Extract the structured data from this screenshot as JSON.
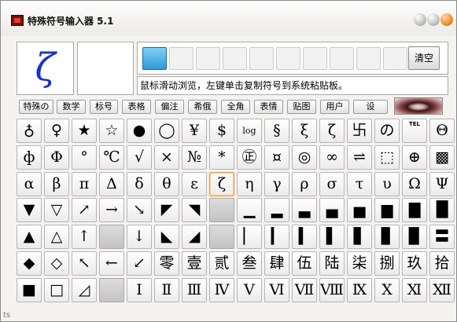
{
  "window": {
    "title": "特殊符号输入器 5.1"
  },
  "preview": {
    "symbol": "ζ"
  },
  "toolbar": {
    "clear_label": "清空"
  },
  "hint": "鼠标滑动浏览，左键单击复制符号到系统粘贴板。",
  "tabs": [
    "特殊の",
    "数学",
    "标号",
    "表格",
    "偏注",
    "希俄",
    "全角",
    "表情",
    "贴图",
    "用户",
    "设"
  ],
  "rows": [
    [
      "♁",
      "♀",
      "★",
      "☆",
      "●",
      "◯",
      "¥",
      "$",
      "log",
      "§",
      "ξ",
      "ζ",
      "卐",
      "の",
      "TEL",
      "Θ"
    ],
    [
      "ф",
      "Φ",
      "°",
      "℃",
      "√",
      "⨯",
      "№",
      "*",
      "㊣",
      "¤",
      "◎",
      "∞",
      "⇌",
      "⬚",
      "⊕",
      "▩"
    ],
    [
      "α",
      "β",
      "π",
      "Δ",
      "δ",
      "θ",
      "ε",
      "ζ",
      "η",
      "γ",
      "ρ",
      "σ",
      "τ",
      "υ",
      "Ω",
      "Ψ"
    ],
    [
      "▼",
      "▽",
      "↗",
      "→",
      "↘",
      "◤",
      "◥",
      "",
      "▁",
      "▂",
      "▃",
      "▄",
      "▅",
      "▆",
      "▇",
      "█"
    ],
    [
      "▲",
      "△",
      "↑",
      "",
      "↓",
      "◣",
      "◢",
      "",
      "▏",
      "▎",
      "▍",
      "▌",
      "▋",
      "▊",
      "▉",
      "〓"
    ],
    [
      "◆",
      "◇",
      "↖",
      "←",
      "↙",
      "零",
      "壹",
      "贰",
      "叁",
      "肆",
      "伍",
      "陆",
      "柒",
      "捌",
      "玖",
      "拾"
    ],
    [
      "■",
      "□",
      "◿",
      "",
      "Ⅰ",
      "Ⅱ",
      "Ⅲ",
      "Ⅳ",
      "Ⅴ",
      "Ⅵ",
      "Ⅶ",
      "Ⅷ",
      "Ⅸ",
      "Ⅹ",
      "Ⅺ",
      "Ⅻ"
    ]
  ],
  "selected": {
    "row": 2,
    "col": 7
  },
  "disabled_cells": [
    "3-7",
    "4-3",
    "4-7",
    "6-3"
  ],
  "status": "ts",
  "colors": {
    "preview_symbol": "#1c31c8",
    "selection": "#ff8c2c",
    "history_active": "#2e9ad5"
  }
}
